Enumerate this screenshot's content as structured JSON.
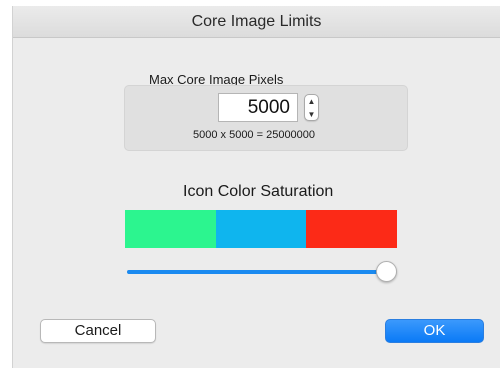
{
  "window": {
    "title": "Core Image Limits"
  },
  "pixels": {
    "label": "Max Core Image Pixels",
    "value": "5000",
    "calculation": "5000 x 5000 = 25000000",
    "stepper_up": "▲",
    "stepper_down": "▼"
  },
  "saturation": {
    "label": "Icon Color Saturation",
    "swatches": [
      {
        "name": "green",
        "color": "#2cf58f"
      },
      {
        "name": "blue",
        "color": "#0fb5ee"
      },
      {
        "name": "red",
        "color": "#fc2a17"
      }
    ],
    "slider_value_fraction": 0.96
  },
  "buttons": {
    "cancel_label": "Cancel",
    "ok_label": "OK"
  },
  "colors": {
    "accent": "#1a8af0",
    "ok_button": "#0a7af6"
  }
}
